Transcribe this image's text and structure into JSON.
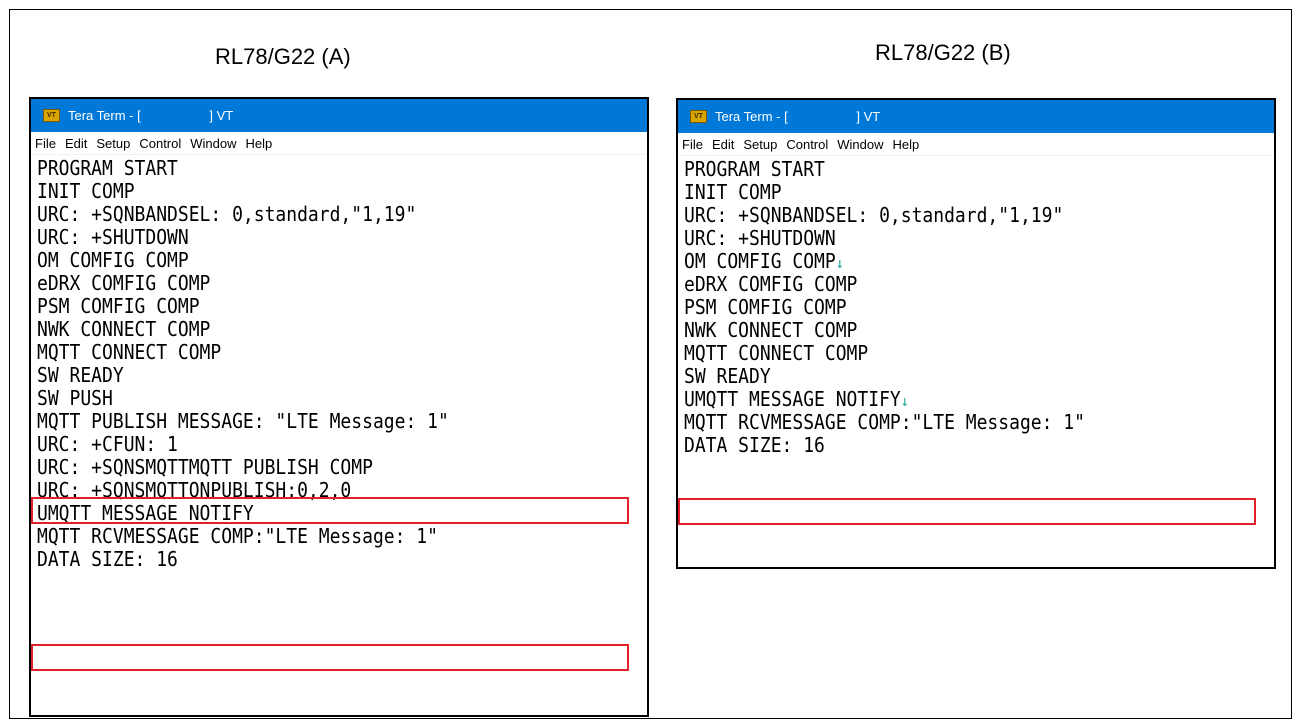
{
  "captions": {
    "left": "RL78/G22 (A)",
    "right": "RL78/G22 (B)"
  },
  "window_left": {
    "title": "Tera Term - [                   ] VT",
    "icon": "VT",
    "menu": [
      "File",
      "Edit",
      "Setup",
      "Control",
      "Window",
      "Help"
    ],
    "lines": [
      "PROGRAM START",
      "INIT COMP",
      "URC: +SQNBANDSEL: 0,standard,\"1,19\"",
      "URC: +SHUTDOWN",
      "OM COMFIG COMP",
      "eDRX COMFIG COMP",
      "PSM COMFIG COMP",
      "NWK CONNECT COMP",
      "MQTT CONNECT COMP",
      "SW READY",
      "SW PUSH",
      "MQTT PUBLISH MESSAGE: \"LTE Message: 1\"",
      "URC: +CFUN: 1",
      "URC: +SQNSMQTTMQTT PUBLISH COMP",
      "URC: +SQNSMQTTONPUBLISH:0,2,0",
      "UMQTT MESSAGE NOTIFY",
      "MQTT RCVMESSAGE COMP:\"LTE Message: 1\"",
      "DATA SIZE: 16"
    ]
  },
  "window_right": {
    "title": "Tera Term - [                   ] VT",
    "icon": "VT",
    "menu": [
      "File",
      "Edit",
      "Setup",
      "Control",
      "Window",
      "Help"
    ],
    "lines": [
      "PROGRAM START",
      "INIT COMP",
      "URC: +SQNBANDSEL: 0,standard,\"1,19\"",
      "URC: +SHUTDOWN",
      "OM COMFIG COMP",
      "eDRX COMFIG COMP",
      "PSM COMFIG COMP",
      "NWK CONNECT COMP",
      "MQTT CONNECT COMP",
      "SW READY",
      "UMQTT MESSAGE NOTIFY",
      "MQTT RCVMESSAGE COMP:\"LTE Message: 1\"",
      "DATA SIZE: 16"
    ],
    "line_break_glyph": "↓"
  },
  "colors": {
    "titlebar": "#0078d7",
    "highlight": "#e0202a",
    "line_break_glyph": "#1aa39a"
  }
}
